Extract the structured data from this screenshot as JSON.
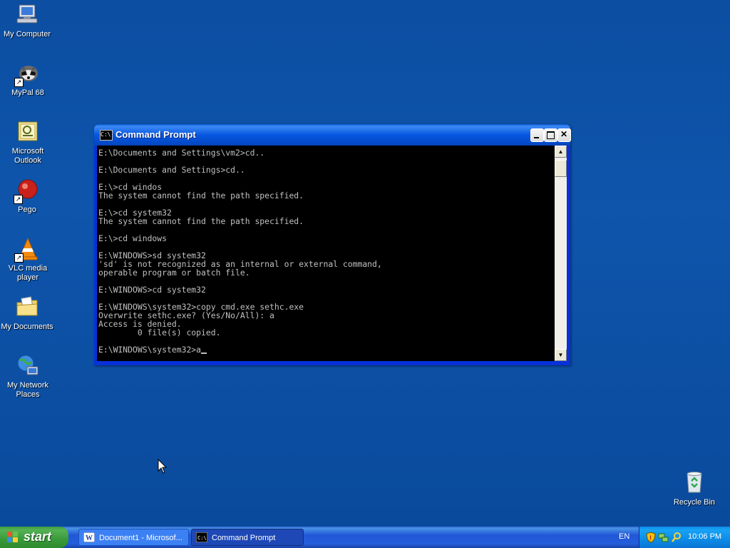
{
  "desktop_icons": [
    {
      "label": "My Computer",
      "icon": "my-computer-icon"
    },
    {
      "label": "MyPal 68",
      "icon": "mypal-icon"
    },
    {
      "label": "Microsoft Outlook",
      "icon": "outlook-icon"
    },
    {
      "label": "Pego",
      "icon": "pego-icon"
    },
    {
      "label": "VLC media player",
      "icon": "vlc-icon"
    },
    {
      "label": "My Documents",
      "icon": "my-documents-icon"
    },
    {
      "label": "My Network Places",
      "icon": "network-places-icon"
    },
    {
      "label": "Recycle Bin",
      "icon": "recycle-bin-icon"
    }
  ],
  "window": {
    "title": "Command Prompt",
    "icon_text": "C:\\",
    "console_text": "E:\\Documents and Settings\\vm2>cd..\n\nE:\\Documents and Settings>cd..\n\nE:\\>cd windos\nThe system cannot find the path specified.\n\nE:\\>cd system32\nThe system cannot find the path specified.\n\nE:\\>cd windows\n\nE:\\WINDOWS>sd system32\n'sd' is not recognized as an internal or external command,\noperable program or batch file.\n\nE:\\WINDOWS>cd system32\n\nE:\\WINDOWS\\system32>copy cmd.exe sethc.exe\nOverwrite sethc.exe? (Yes/No/All): a\nAccess is denied.\n        0 file(s) copied.\n\nE:\\WINDOWS\\system32>a"
  },
  "taskbar": {
    "start_label": "start",
    "tasks": [
      {
        "label": "Document1 - Microsof...",
        "icon": "word-icon"
      },
      {
        "label": "Command Prompt",
        "icon": "cmd-icon"
      }
    ],
    "language": "EN",
    "clock": "10:06 PM"
  },
  "colors": {
    "desktop": "#0b4ea2",
    "console_bg": "#000000",
    "console_text": "#c0c0c0",
    "start_green": "#3c9a3c"
  }
}
